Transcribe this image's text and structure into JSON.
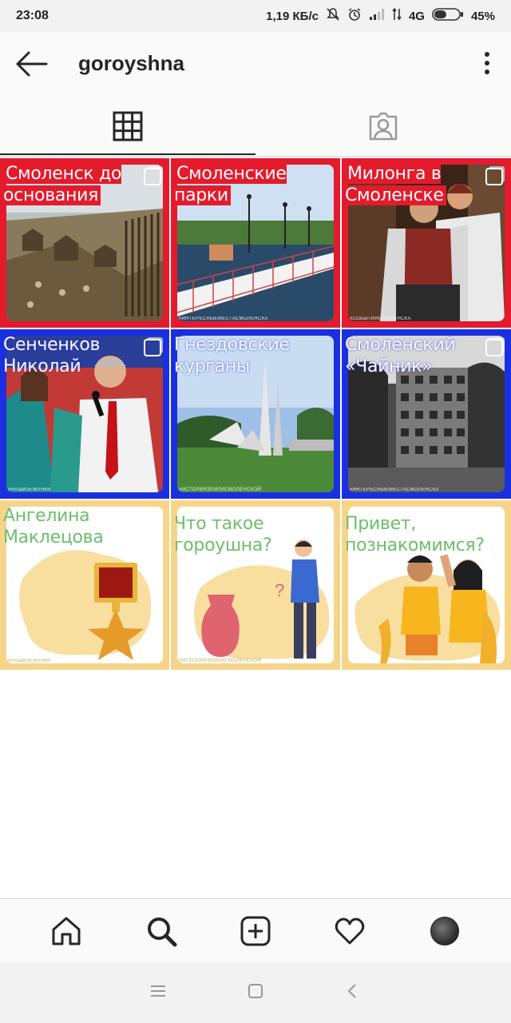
{
  "status_bar": {
    "time": "23:08",
    "network_speed": "1,19 КБ/с",
    "network_type": "4G",
    "battery": "45%",
    "icons": [
      "mute-icon",
      "alarm-icon",
      "signal-icon",
      "data-arrows-icon",
      "battery-icon"
    ]
  },
  "header": {
    "username": "goroyshna",
    "back_icon": "arrow-left-icon",
    "menu_icon": "more-vertical-icon"
  },
  "tabs": [
    {
      "name": "grid",
      "icon": "grid-icon",
      "active": true
    },
    {
      "name": "tagged",
      "icon": "tagged-person-icon",
      "active": false
    }
  ],
  "posts": [
    {
      "caption": "Смоленск до основания",
      "theme": "red",
      "multi": true,
      "scene": "ancient-settlement"
    },
    {
      "caption": "Смоленские парки",
      "theme": "red",
      "multi": false,
      "scene": "park-bridge",
      "tag": "#ИНТЕРЕСНЫЕМЕСТАСМОЛЕНСКА"
    },
    {
      "caption": "Милонга в Смоленске",
      "theme": "red",
      "multi": true,
      "scene": "tango-couple",
      "tag": "#СОБЫТИЯСМОЛЕНСКА"
    },
    {
      "caption": "Сенченков Николай",
      "theme": "blue",
      "multi": true,
      "scene": "speaker-microphone",
      "tag": "#НАШИЗЕМЛЯКИ"
    },
    {
      "caption": "Гнездовские курганы",
      "theme": "blue",
      "multi": false,
      "scene": "monument",
      "tag": "#ИСТОРИЯЗЕМЛИСМОЛЕНСКОЙ"
    },
    {
      "caption": "Смоленский «Чайник»",
      "theme": "blue",
      "multi": true,
      "scene": "abandoned-building",
      "tag": "#ИНТЕРЕСНЫЕМЕСТАСМОЛЕНСКА"
    },
    {
      "caption": "Ангелина Маклецова",
      "theme": "yellow",
      "multi": true,
      "scene": "hero-star-medal",
      "tag": "#НАШИЗЕМЛЯКИ"
    },
    {
      "caption": "Что такое гороушна?",
      "theme": "yellow",
      "multi": false,
      "scene": "vase-question",
      "tag": "#ИСТОРИЯЗЕМЛИСМОЛЕНСКОЙ"
    },
    {
      "caption": "Привет, познакомимся?",
      "theme": "yellow",
      "multi": false,
      "scene": "two-kids"
    }
  ],
  "bottom_nav": [
    {
      "name": "home",
      "icon": "home-icon"
    },
    {
      "name": "search",
      "icon": "search-icon",
      "active": true
    },
    {
      "name": "new-post",
      "icon": "plus-square-icon"
    },
    {
      "name": "activity",
      "icon": "heart-icon"
    },
    {
      "name": "profile",
      "icon": "avatar"
    }
  ],
  "system_nav": [
    "menu-icon",
    "home-square-icon",
    "back-chevron-icon"
  ],
  "colors": {
    "red_theme": "#e31b2c",
    "blue_theme": "#1a2fe0",
    "yellow_theme": "#f6d58a",
    "caption_green": "#6cbf6a"
  }
}
